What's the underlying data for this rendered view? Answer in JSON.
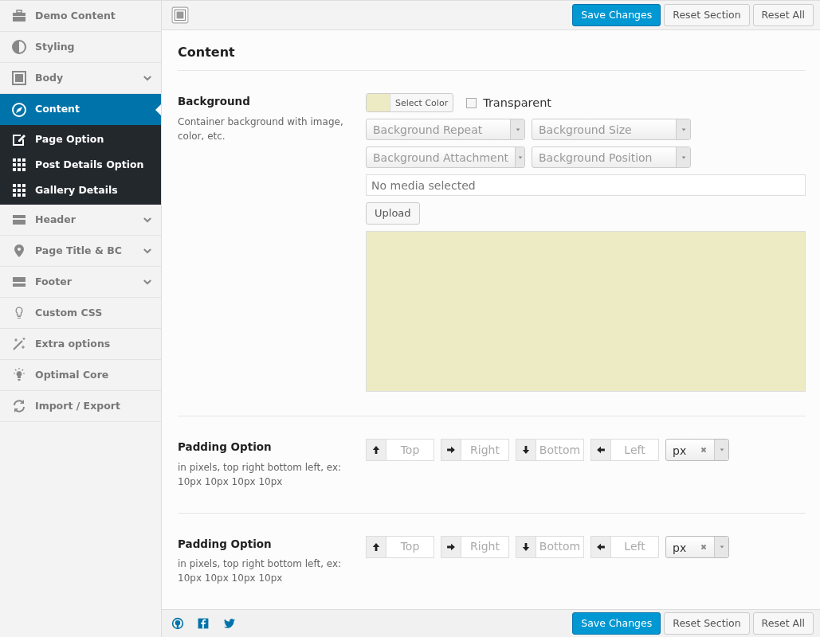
{
  "sidebar": {
    "items": [
      {
        "label": "Demo Content",
        "selected": false
      },
      {
        "label": "Styling",
        "selected": false
      },
      {
        "label": "Body",
        "selected": false,
        "expanded": false
      },
      {
        "label": "Content",
        "selected": true,
        "expanded": true,
        "children": [
          {
            "label": "Page Option"
          },
          {
            "label": "Post Details Option"
          },
          {
            "label": "Gallery Details"
          }
        ]
      },
      {
        "label": "Header",
        "selected": false,
        "expanded": false
      },
      {
        "label": "Page Title & BC",
        "selected": false,
        "expanded": false
      },
      {
        "label": "Footer",
        "selected": false,
        "expanded": false
      },
      {
        "label": "Custom CSS",
        "selected": false
      },
      {
        "label": "Extra options",
        "selected": false
      },
      {
        "label": "Optimal Core",
        "selected": false
      },
      {
        "label": "Import / Export",
        "selected": false
      }
    ]
  },
  "toolbar": {
    "buttons": [
      {
        "label": "Save Changes",
        "kind": "primary"
      },
      {
        "label": "Reset Section",
        "kind": "default"
      },
      {
        "label": "Reset All",
        "kind": "default"
      }
    ]
  },
  "section": {
    "title": "Content"
  },
  "background": {
    "title": "Background",
    "description": "Container background with image, color, etc.",
    "color": "#ecebc4",
    "select_color": "Select Color",
    "transparent": {
      "label": "Transparent",
      "checked": false
    },
    "selects": [
      {
        "placeholder": "Background Repeat"
      },
      {
        "placeholder": "Background Size"
      },
      {
        "placeholder": "Background Attachment"
      },
      {
        "placeholder": "Background Position"
      }
    ],
    "media": {
      "placeholder": "No media selected"
    },
    "upload": "Upload"
  },
  "padding_options": [
    {
      "title": "Padding Option",
      "description": "in pixels, top right bottom left, ex: 10px 10px 10px 10px",
      "inputs": [
        {
          "placeholder": "Top"
        },
        {
          "placeholder": "Right"
        },
        {
          "placeholder": "Bottom"
        },
        {
          "placeholder": "Left"
        }
      ],
      "unit": "px"
    },
    {
      "title": "Padding Option",
      "description": "in pixels, top right bottom left, ex: 10px 10px 10px 10px",
      "inputs": [
        {
          "placeholder": "Top"
        },
        {
          "placeholder": "Right"
        },
        {
          "placeholder": "Bottom"
        },
        {
          "placeholder": "Left"
        }
      ],
      "unit": "px"
    }
  ],
  "footer": {
    "buttons": [
      {
        "label": "Save Changes",
        "kind": "primary"
      },
      {
        "label": "Reset Section",
        "kind": "default"
      },
      {
        "label": "Reset All",
        "kind": "default"
      }
    ]
  }
}
